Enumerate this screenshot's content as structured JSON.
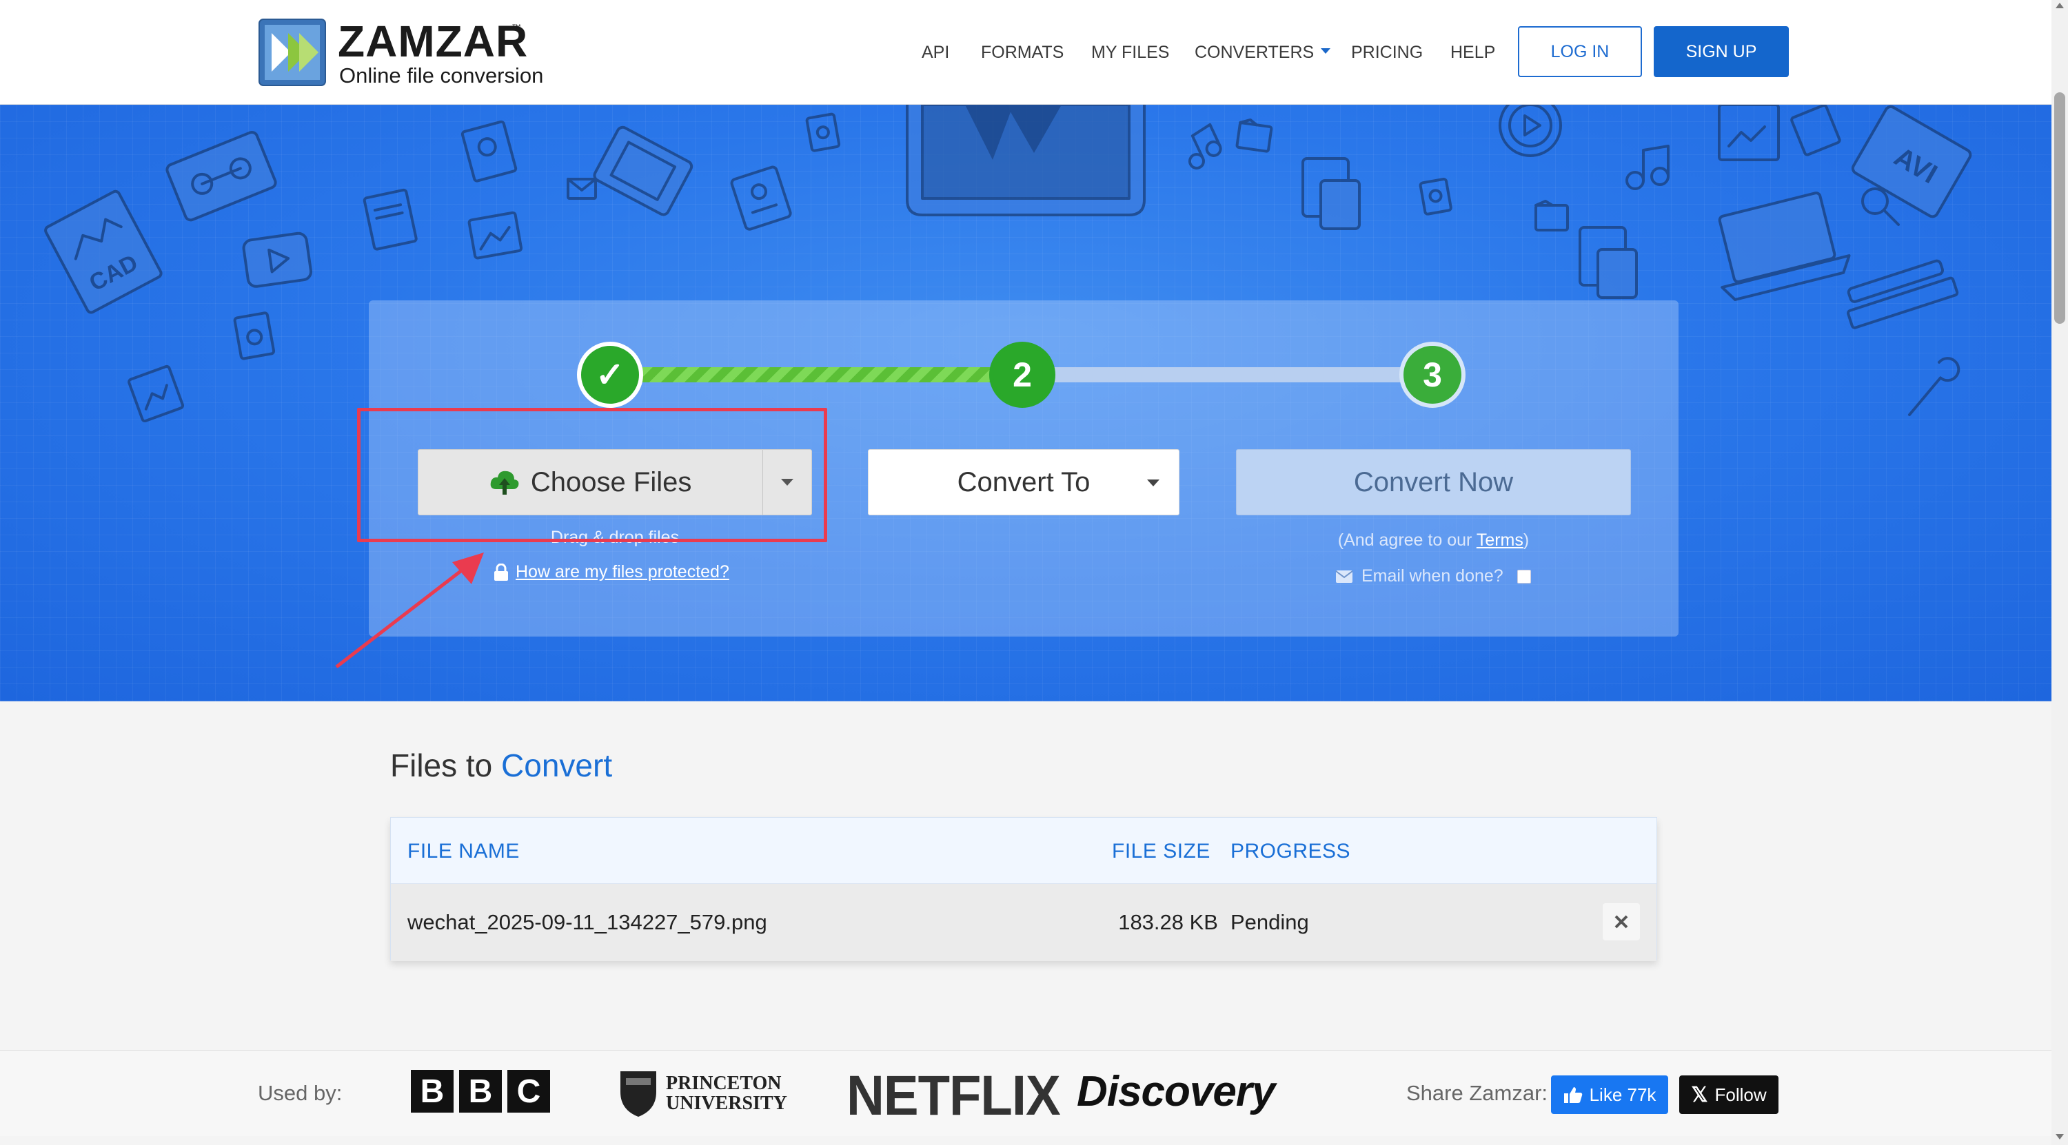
{
  "brand": {
    "name": "ZAMZAR",
    "trademark": "™",
    "tagline": "Online file conversion"
  },
  "nav": {
    "items": [
      "API",
      "FORMATS",
      "MY FILES",
      "CONVERTERS",
      "PRICING",
      "HELP"
    ],
    "login_label": "LOG IN",
    "signup_label": "SIGN UP"
  },
  "steps": {
    "step1_glyph": "✓",
    "step2_number": "2",
    "step3_number": "3"
  },
  "converter": {
    "choose_files_label": "Choose Files",
    "drag_drop_text": "Drag & drop files",
    "protected_link": "How are my files protected?",
    "convert_to_label": "Convert To",
    "convert_now_label": "Convert Now",
    "agree_prefix": "(And agree to our ",
    "agree_terms": "Terms",
    "agree_suffix": ")",
    "email_label": "Email when done?"
  },
  "files": {
    "title_prefix": "Files to",
    "title_accent": "Convert",
    "columns": [
      "FILE NAME",
      "FILE SIZE",
      "PROGRESS"
    ],
    "rows": [
      {
        "name": "wechat_2025-09-11_134227_579.png",
        "size": "183.28 KB",
        "progress": "Pending"
      }
    ]
  },
  "footer": {
    "used_by_label": "Used by:",
    "logos": [
      "B",
      "B",
      "C",
      "PRINCETON",
      "UNIVERSITY",
      "NETFLIX",
      "Discovery"
    ],
    "share_label": "Share Zamzar:",
    "like_label": "Like 77k",
    "follow_label": "Follow",
    "x_glyph": "𝕏"
  },
  "colors": {
    "brand_blue": "#1466cc",
    "hero_blue": "#2a77ea",
    "success_green": "#2aa82a",
    "highlight_red": "#ea3b4f"
  }
}
